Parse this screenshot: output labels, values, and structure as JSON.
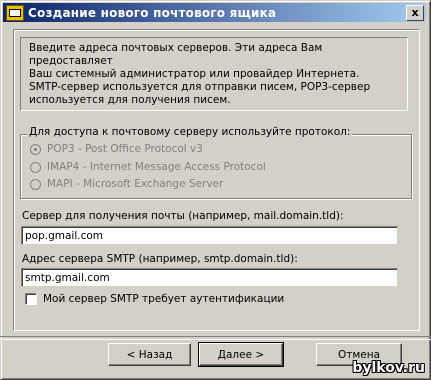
{
  "window": {
    "title": "Создание нового почтового ящика",
    "close_label": "x"
  },
  "info": {
    "lines": [
      "Введите адреса почтовых серверов. Эти адреса Вам предоставляет",
      "Ваш системный администратор или провайдер Интернета.",
      "SMTP-сервер используется для отправки писем, POP3-сервер",
      "используется для получения писем."
    ]
  },
  "protocol": {
    "legend": "Для доступа к почтовому серверу используйте протокол:",
    "options": [
      {
        "label": "POP3  -  Post Office Protocol v3",
        "checked": true
      },
      {
        "label": "IMAP4 - Internet Message Access Protocol",
        "checked": false
      },
      {
        "label": "MAPI - Microsoft Exchange Server",
        "checked": false
      }
    ]
  },
  "incoming": {
    "label": "Сервер для получения почты  (например, mail.domain.tld):",
    "value": "pop.gmail.com"
  },
  "smtp": {
    "label": "Адрес сервера SMTP (например, smtp.domain.tld):",
    "value": "smtp.gmail.com"
  },
  "auth": {
    "label": "Мой сервер SMTP требует аутентификации",
    "checked": false
  },
  "buttons": {
    "back": "<  Назад",
    "next": "Далее  >",
    "cancel": "Отмена"
  },
  "watermark": "bylkov.ru"
}
